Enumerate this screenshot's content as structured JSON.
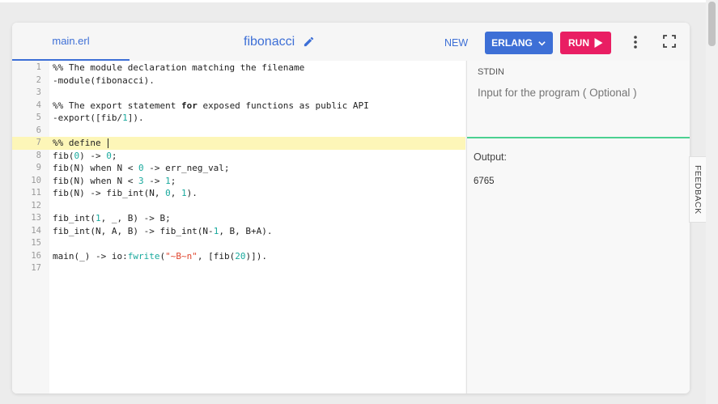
{
  "header": {
    "file_tab": "main.erl",
    "project_name": "fibonacci",
    "new_label": "NEW",
    "language_label": "ERLANG",
    "run_label": "RUN"
  },
  "editor": {
    "lines": [
      {
        "n": "1",
        "code": "%% The module declaration matching the filename"
      },
      {
        "n": "2",
        "code": "-module(fibonacci)."
      },
      {
        "n": "3",
        "code": ""
      },
      {
        "n": "4",
        "code": "%% The export statement for exposed functions as public API"
      },
      {
        "n": "5",
        "code": "-export([fib/1])."
      },
      {
        "n": "6",
        "code": ""
      },
      {
        "n": "7",
        "code": "%% define "
      },
      {
        "n": "8",
        "code": "fib(0) -> 0;"
      },
      {
        "n": "9",
        "code": "fib(N) when N < 0 -> err_neg_val;"
      },
      {
        "n": "10",
        "code": "fib(N) when N < 3 -> 1;"
      },
      {
        "n": "11",
        "code": "fib(N) -> fib_int(N, 0, 1)."
      },
      {
        "n": "12",
        "code": ""
      },
      {
        "n": "13",
        "code": "fib_int(1, _, B) -> B;"
      },
      {
        "n": "14",
        "code": "fib_int(N, A, B) -> fib_int(N-1, B, B+A)."
      },
      {
        "n": "15",
        "code": ""
      },
      {
        "n": "16",
        "code": "main(_) -> io:fwrite(\"~B~n\", [fib(20)])."
      },
      {
        "n": "17",
        "code": ""
      }
    ],
    "active_line": "7"
  },
  "stdin": {
    "label": "STDIN",
    "placeholder": "Input for the program ( Optional )"
  },
  "output": {
    "label": "Output:",
    "value": "6765"
  },
  "feedback_label": "FEEDBACK",
  "colors": {
    "accent_blue": "#3d6fd6",
    "run_pink": "#e91e63",
    "divider_green": "#4cd191",
    "active_line_bg": "#fdf6b8"
  },
  "icons": [
    "pencil-icon",
    "chevron-down-icon",
    "play-icon",
    "more-vertical-icon",
    "fullscreen-icon"
  ]
}
